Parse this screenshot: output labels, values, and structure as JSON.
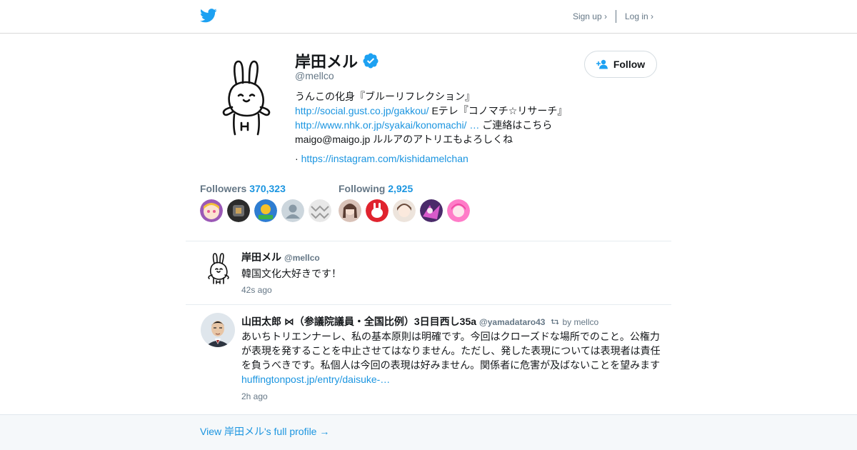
{
  "brand": {
    "icon": "twitter-bird-icon",
    "color": "#1da1f2"
  },
  "topnav": {
    "signup": "Sign up ›",
    "login": "Log in ›"
  },
  "profile": {
    "name": "岸田メル",
    "verified_icon": "verified-badge-icon",
    "handle": "@mellco",
    "bio_lines": [
      {
        "text": "うんこの化身『ブルーリフレクション』"
      },
      {
        "link": "http://social.gust.co.jp/gakkou/",
        "text": " Eテレ『コノマチ☆リサーチ』"
      },
      {
        "link": "http://www.nhk.or.jp/syakai/konomachi/ …",
        "text": " ご連絡はこちら"
      },
      {
        "text": "maigo@maigo.jp ルルアのアトリエもよろしくね"
      }
    ],
    "website_prefix": "· ",
    "website": "https://instagram.com/kishidamelchan",
    "follow_label": "Follow"
  },
  "stats": {
    "followers_label": "Followers",
    "followers_count": "370,323",
    "following_label": "Following",
    "following_count": "2,925"
  },
  "tweets": [
    {
      "name": "岸田メル",
      "handle": "@mellco",
      "text_lines": [
        "韓国文化大好きです！"
      ],
      "time": "42s ago"
    },
    {
      "name": "山田太郎 ⋈（参議院議員・全国比例）3日目西し35a",
      "handle": "@yamadataro43",
      "retweet_by": "by mellco",
      "text_lines": [
        "あいちトリエンナーレ、私の基本原則は明確です。今回はクローズドな場所でのこと。公権力",
        "が表現を発することを中止させてはなりません。ただし、発した表現については表現者は責任",
        "を負うべきです。私個人は今回の表現は好みません。関係者に危害が及ばないことを望みます"
      ],
      "link": "huffingtonpost.jp/entry/daisuke-…",
      "time": "2h ago"
    }
  ],
  "footer": {
    "link": "View 岸田メル's full profile →"
  }
}
